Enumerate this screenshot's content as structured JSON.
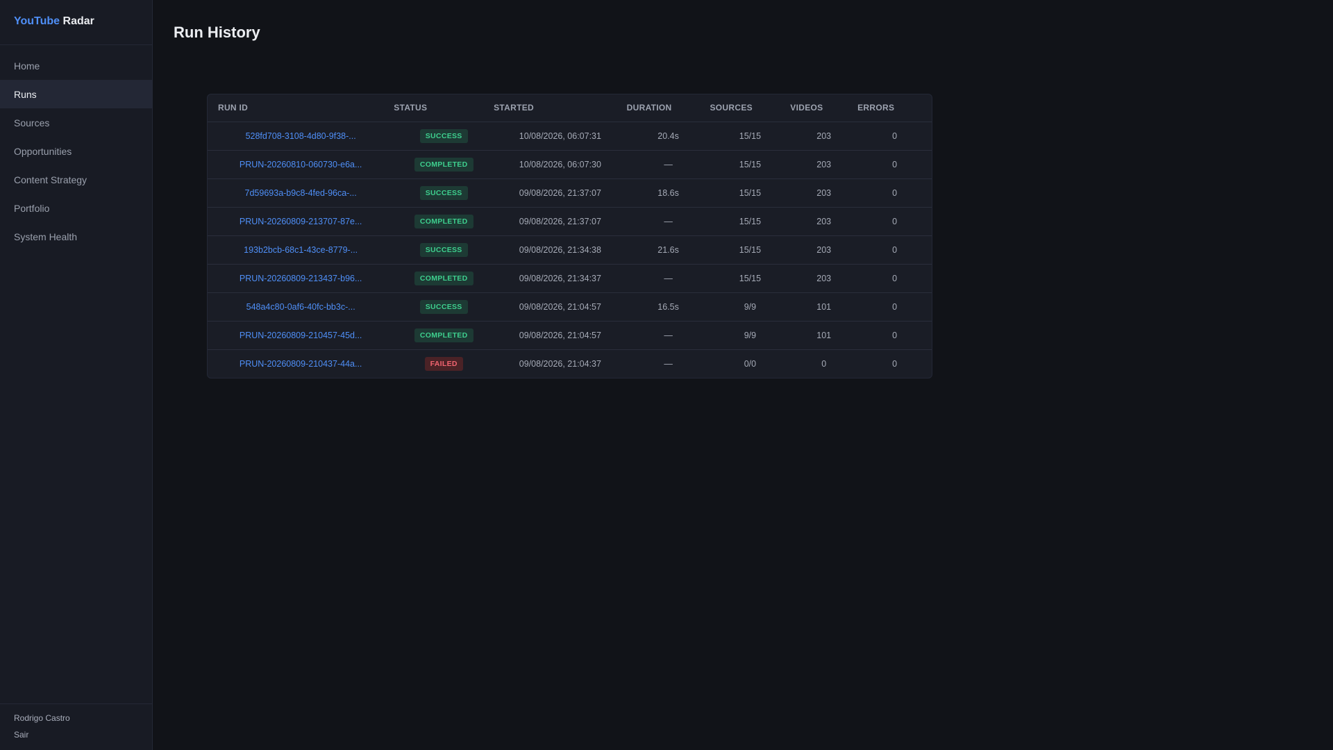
{
  "brand": {
    "part1": "YouTube",
    "part2": "Radar"
  },
  "sidebar": {
    "items": [
      {
        "label": "Home",
        "active": false
      },
      {
        "label": "Runs",
        "active": true
      },
      {
        "label": "Sources",
        "active": false
      },
      {
        "label": "Opportunities",
        "active": false
      },
      {
        "label": "Content Strategy",
        "active": false
      },
      {
        "label": "Portfolio",
        "active": false
      },
      {
        "label": "System Health",
        "active": false
      }
    ],
    "user_name": "Rodrigo Castro",
    "logout_label": "Sair"
  },
  "page": {
    "title": "Run History"
  },
  "table": {
    "headers": [
      "RUN ID",
      "STATUS",
      "STARTED",
      "DURATION",
      "SOURCES",
      "VIDEOS",
      "ERRORS"
    ],
    "rows": [
      {
        "run_id": "528fd708-3108-4d80-9f38-...",
        "status": "SUCCESS",
        "started": "10/08/2026, 06:07:31",
        "duration": "20.4s",
        "sources": "15/15",
        "videos": "203",
        "errors": "0"
      },
      {
        "run_id": "PRUN-20260810-060730-e6a...",
        "status": "COMPLETED",
        "started": "10/08/2026, 06:07:30",
        "duration": "—",
        "sources": "15/15",
        "videos": "203",
        "errors": "0"
      },
      {
        "run_id": "7d59693a-b9c8-4fed-96ca-...",
        "status": "SUCCESS",
        "started": "09/08/2026, 21:37:07",
        "duration": "18.6s",
        "sources": "15/15",
        "videos": "203",
        "errors": "0"
      },
      {
        "run_id": "PRUN-20260809-213707-87e...",
        "status": "COMPLETED",
        "started": "09/08/2026, 21:37:07",
        "duration": "—",
        "sources": "15/15",
        "videos": "203",
        "errors": "0"
      },
      {
        "run_id": "193b2bcb-68c1-43ce-8779-...",
        "status": "SUCCESS",
        "started": "09/08/2026, 21:34:38",
        "duration": "21.6s",
        "sources": "15/15",
        "videos": "203",
        "errors": "0"
      },
      {
        "run_id": "PRUN-20260809-213437-b96...",
        "status": "COMPLETED",
        "started": "09/08/2026, 21:34:37",
        "duration": "—",
        "sources": "15/15",
        "videos": "203",
        "errors": "0"
      },
      {
        "run_id": "548a4c80-0af6-40fc-bb3c-...",
        "status": "SUCCESS",
        "started": "09/08/2026, 21:04:57",
        "duration": "16.5s",
        "sources": "9/9",
        "videos": "101",
        "errors": "0"
      },
      {
        "run_id": "PRUN-20260809-210457-45d...",
        "status": "COMPLETED",
        "started": "09/08/2026, 21:04:57",
        "duration": "—",
        "sources": "9/9",
        "videos": "101",
        "errors": "0"
      },
      {
        "run_id": "PRUN-20260809-210437-44a...",
        "status": "FAILED",
        "started": "09/08/2026, 21:04:37",
        "duration": "—",
        "sources": "0/0",
        "videos": "0",
        "errors": "0"
      }
    ]
  },
  "colors": {
    "accent": "#4f8ff7",
    "success": "#3ecf8e",
    "failed": "#f06470",
    "background": "#111318",
    "sidebar": "#181b24"
  }
}
